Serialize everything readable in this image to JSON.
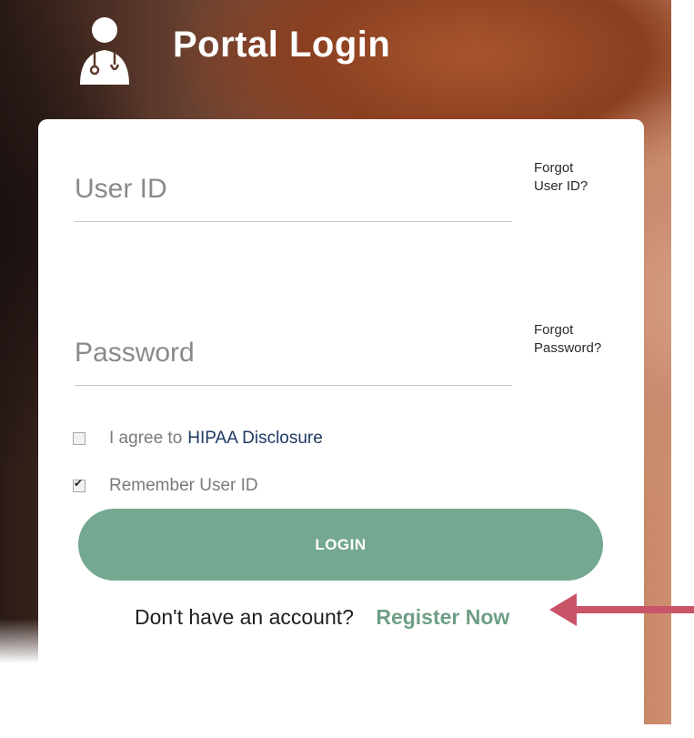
{
  "header": {
    "title": "Portal Login",
    "icon": "doctor-icon"
  },
  "form": {
    "user_id_placeholder": "User ID",
    "password_placeholder": "Password",
    "forgot_user_id_line1": "Forgot",
    "forgot_user_id_line2": "User ID?",
    "forgot_password_line1": "Forgot",
    "forgot_password_line2": "Password?",
    "hipaa_prefix": "I agree to",
    "hipaa_link": "HIPAA Disclosure",
    "hipaa_checked": false,
    "remember_label": "Remember User ID",
    "remember_checked": true,
    "login_label": "LOGIN",
    "no_account_text": "Don't have an account?",
    "register_link": "Register Now"
  },
  "colors": {
    "accent_green": "#74a890",
    "register_green": "#6e9f85",
    "link_navy": "#1e3a63",
    "arrow": "#c85468"
  },
  "annotations": {
    "arrow_icon": "left-arrow-icon"
  }
}
